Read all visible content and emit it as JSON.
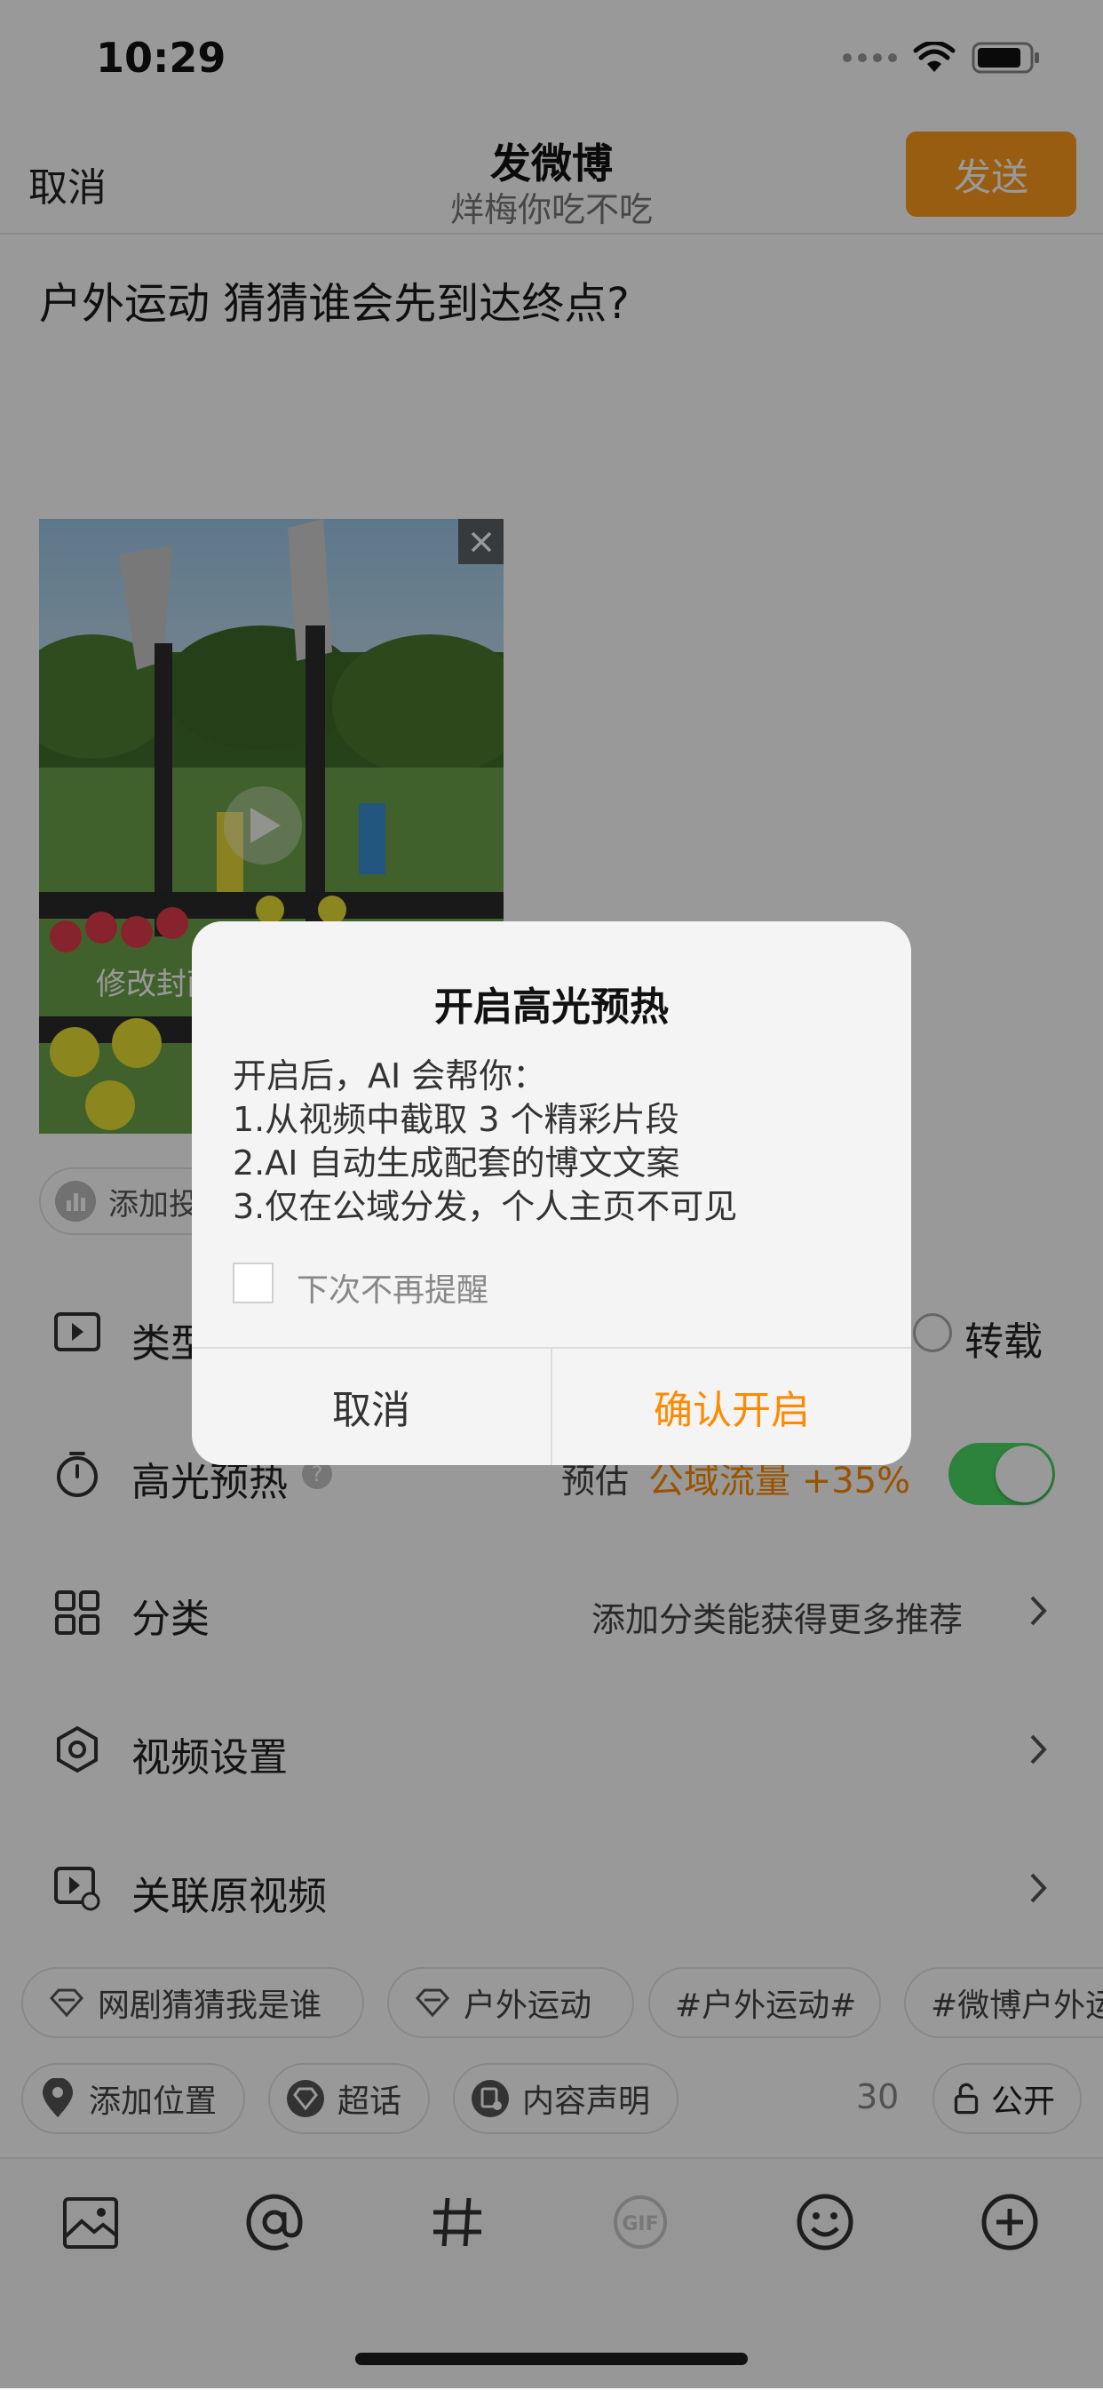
{
  "status_bar": {
    "time": "10:29"
  },
  "header": {
    "cancel_label": "取消",
    "title": "发微博",
    "subtitle": "烊梅你吃不吃",
    "send_label": "发送"
  },
  "post": {
    "text": "户外运动 猜猜谁会先到达终点?",
    "cover_label": "修改封面",
    "poll_label": "添加投票"
  },
  "rows": {
    "type": {
      "label": "类型",
      "option_repost": "转载"
    },
    "highlight": {
      "label": "高光预热",
      "estimate_prefix": "预估",
      "estimate_value": "公域流量 +35%",
      "toggle_on": true
    },
    "category": {
      "label": "分类",
      "hint": "添加分类能获得更多推荐"
    },
    "video_settings": {
      "label": "视频设置"
    },
    "link_video": {
      "label": "关联原视频"
    }
  },
  "topic_tags": [
    "网剧猜猜我是谁",
    "户外运动",
    "#户外运动#",
    "#微博户外运"
  ],
  "meta_tags": {
    "location": "添加位置",
    "super_topic": "超话",
    "content_statement": "内容声明",
    "char_count": "30",
    "visibility": "公开"
  },
  "toolbar": [
    "image-icon",
    "at-icon",
    "hashtag-icon",
    "gif-icon",
    "emoji-icon",
    "plus-icon"
  ],
  "dialog": {
    "title": "开启高光预热",
    "body": [
      "开启后，AI 会帮你：",
      "1.从视频中截取 3 个精彩片段",
      "2.AI 自动生成配套的博文文案",
      "3.仅在公域分发，个人主页不可见"
    ],
    "checkbox_label": "下次不再提醒",
    "cancel_label": "取消",
    "confirm_label": "确认开启"
  },
  "colors": {
    "accent": "#ff9c1e",
    "confirm": "#ff8a00",
    "toggle_on": "#4cd964"
  }
}
